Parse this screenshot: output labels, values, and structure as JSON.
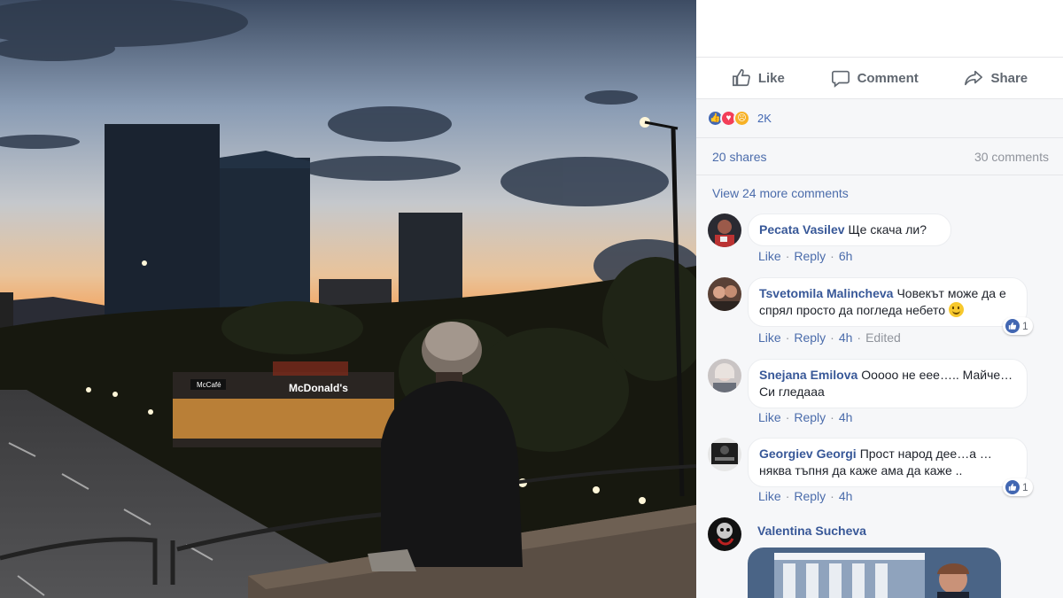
{
  "post": {
    "actions": {
      "like": "Like",
      "comment": "Comment",
      "share": "Share"
    },
    "reaction_count": "2K",
    "shares": "20 shares",
    "comments_count": "30 comments",
    "view_more": "View 24 more comments"
  },
  "comments": [
    {
      "name": "Pecata Vasilev",
      "text": "Ще скача ли?",
      "like": "Like",
      "reply": "Reply",
      "time": "6h"
    },
    {
      "name": "Tsvetomila Malincheva",
      "text": "Човекът може да е спрял просто да погледа небето",
      "like": "Like",
      "reply": "Reply",
      "time": "4h",
      "edited": "Edited",
      "likes": "1"
    },
    {
      "name": "Snejana Emilova",
      "text": "Ооооо не еее….. Майче… Си гледааа",
      "like": "Like",
      "reply": "Reply",
      "time": "4h"
    },
    {
      "name": "Georgiev Georgi",
      "text": "Прост народ дее…а … няква тъпня да каже ама да каже ..",
      "like": "Like",
      "reply": "Reply",
      "time": "4h",
      "likes": "1"
    },
    {
      "name": "Valentina Sucheva"
    }
  ],
  "photo": {
    "sign_text": "McDonald's",
    "sign_small": "McCafé"
  },
  "colors": {
    "link": "#385898",
    "accent": "#4267b2",
    "panel_bg": "#f6f7f9"
  }
}
